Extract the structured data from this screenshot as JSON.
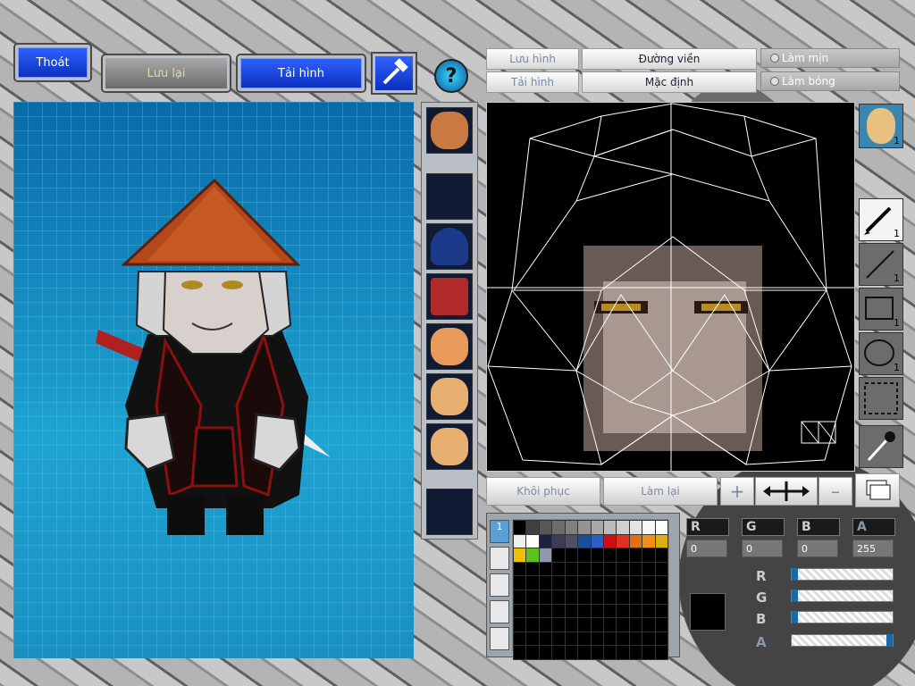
{
  "top_buttons": {
    "exit": "Thoát",
    "save": "Lưu lại",
    "load": "Tải hình"
  },
  "icons": {
    "hammer": "hammer-icon",
    "help": "help-icon",
    "help_glyph": "?"
  },
  "editor_top": {
    "save_image": "Lưu hình",
    "load_image": "Tải hình",
    "outline": "Đường viền",
    "default": "Mặc định",
    "smooth": "Làm mịn",
    "shade": "Làm bóng"
  },
  "tools": [
    {
      "name": "pen",
      "count": "1"
    },
    {
      "name": "line",
      "count": "1"
    },
    {
      "name": "rect",
      "count": "1"
    },
    {
      "name": "ellipse",
      "count": "1"
    },
    {
      "name": "select",
      "count": ""
    },
    {
      "name": "eyedropper",
      "count": ""
    }
  ],
  "face_count": "1",
  "bottom_buttons": {
    "restore": "Khôi phục",
    "redo": "Làm lại",
    "plus": "+",
    "minus": "–"
  },
  "palette": {
    "tab_label": "1",
    "colors": [
      "#000000",
      "#404040",
      "#585858",
      "#6c6c6c",
      "#808080",
      "#949494",
      "#a8a8a8",
      "#bcbcbc",
      "#d0d0d0",
      "#e4e4e4",
      "#f8f8f8",
      "#ffffff",
      "#f0f0f0",
      "#ffffff",
      "#202040",
      "#3c3c58",
      "#505064",
      "#1a4fa0",
      "#2c5fbf",
      "#d01010",
      "#e03020",
      "#e07010",
      "#f09018",
      "#d8b010",
      "#f0c000",
      "#60c020",
      "#9098b0"
    ]
  },
  "channels": {
    "r_label": "R",
    "g_label": "G",
    "b_label": "B",
    "a_label": "A",
    "r": "0",
    "g": "0",
    "b": "0",
    "a": "255"
  },
  "current_color": "#000000",
  "sliders": [
    {
      "label": "R",
      "value": 0
    },
    {
      "label": "G",
      "value": 0
    },
    {
      "label": "B",
      "value": 0
    },
    {
      "label": "A",
      "value": 255
    }
  ]
}
